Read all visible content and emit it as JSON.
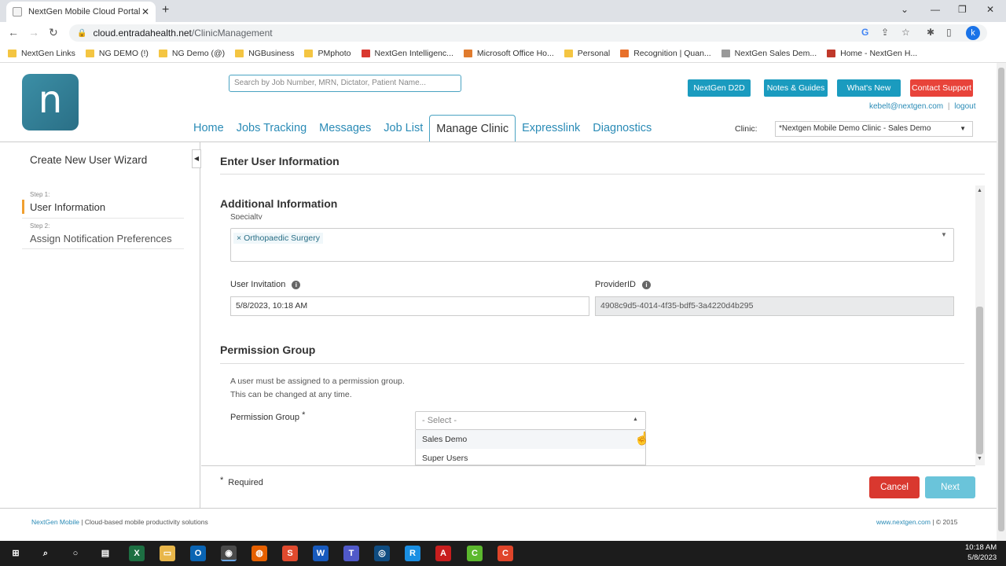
{
  "browser": {
    "tab_title": "NextGen Mobile Cloud Portal",
    "url_host": "cloud.entradahealth.net",
    "url_path": "/ClinicManagement",
    "profile_initial": "k",
    "bookmarks": [
      {
        "label": "NextGen Links",
        "color": "#f4c542"
      },
      {
        "label": "NG DEMO (!)",
        "color": "#f4c542"
      },
      {
        "label": "NG Demo (@)",
        "color": "#f4c542"
      },
      {
        "label": "NGBusiness",
        "color": "#f4c542"
      },
      {
        "label": "PMphoto",
        "color": "#f4c542"
      },
      {
        "label": "NextGen Intelligenc...",
        "color": "#d9382f"
      },
      {
        "label": "Microsoft Office Ho...",
        "color": "#e07b2e"
      },
      {
        "label": "Personal",
        "color": "#f4c542"
      },
      {
        "label": "Recognition | Quan...",
        "color": "#e8702a"
      },
      {
        "label": "NextGen Sales Dem...",
        "color": "#999999"
      },
      {
        "label": "Home - NextGen H...",
        "color": "#c0392b"
      }
    ]
  },
  "header": {
    "logo_letter": "n",
    "search_placeholder": "Search by Job Number, MRN, Dictator, Patient Name...",
    "buttons": [
      {
        "label": "NextGen D2D",
        "color": "#1a9bbf"
      },
      {
        "label": "Notes & Guides",
        "color": "#1a9bbf"
      },
      {
        "label": "What's New",
        "color": "#1a9bbf"
      },
      {
        "label": "Contact Support",
        "color": "#e8433a"
      }
    ],
    "user_email": "kebelt@nextgen.com",
    "logout": "logout",
    "nav": [
      "Home",
      "Jobs Tracking",
      "Messages",
      "Job List",
      "Manage Clinic",
      "Expresslink",
      "Diagnostics"
    ],
    "active_nav": "Manage Clinic",
    "clinic_label": "Clinic:",
    "clinic_value": "*Nextgen Mobile Demo Clinic - Sales Demo"
  },
  "sidebar": {
    "title": "Create New User Wizard",
    "steps": [
      {
        "step_label": "Step 1:",
        "name": "User Information",
        "active": true
      },
      {
        "step_label": "Step 2:",
        "name": "Assign Notification Preferences",
        "active": false
      }
    ]
  },
  "main": {
    "section_title": "Enter User Information",
    "additional_title": "Additional Information",
    "specialty_label": "Specialty",
    "specialty_tags": [
      "Orthopaedic Surgery"
    ],
    "invitation_label": "User Invitation",
    "invitation_value": "5/8/2023, 10:18 AM",
    "provider_label": "ProviderID",
    "provider_value": "4908c9d5-4014-4f35-bdf5-3a4220d4b295",
    "permission_title": "Permission Group",
    "permission_desc_1": "A user must be assigned to a permission group.",
    "permission_desc_2": "This can be changed at any time.",
    "permission_label": "Permission Group",
    "permission_required_mark": "*",
    "permission_placeholder": "- Select -",
    "permission_options": [
      "Sales Demo",
      "Super Users"
    ],
    "required_mark": "*",
    "required_text": "Required",
    "cancel_label": "Cancel",
    "next_label": "Next"
  },
  "footer": {
    "brand": "NextGen Mobile",
    "tagline": " | Cloud-based mobile productivity solutions",
    "site": "www.nextgen.com",
    "copyright": " | © 2015"
  },
  "taskbar": {
    "time": "10:18 AM",
    "date": "5/8/2023"
  }
}
